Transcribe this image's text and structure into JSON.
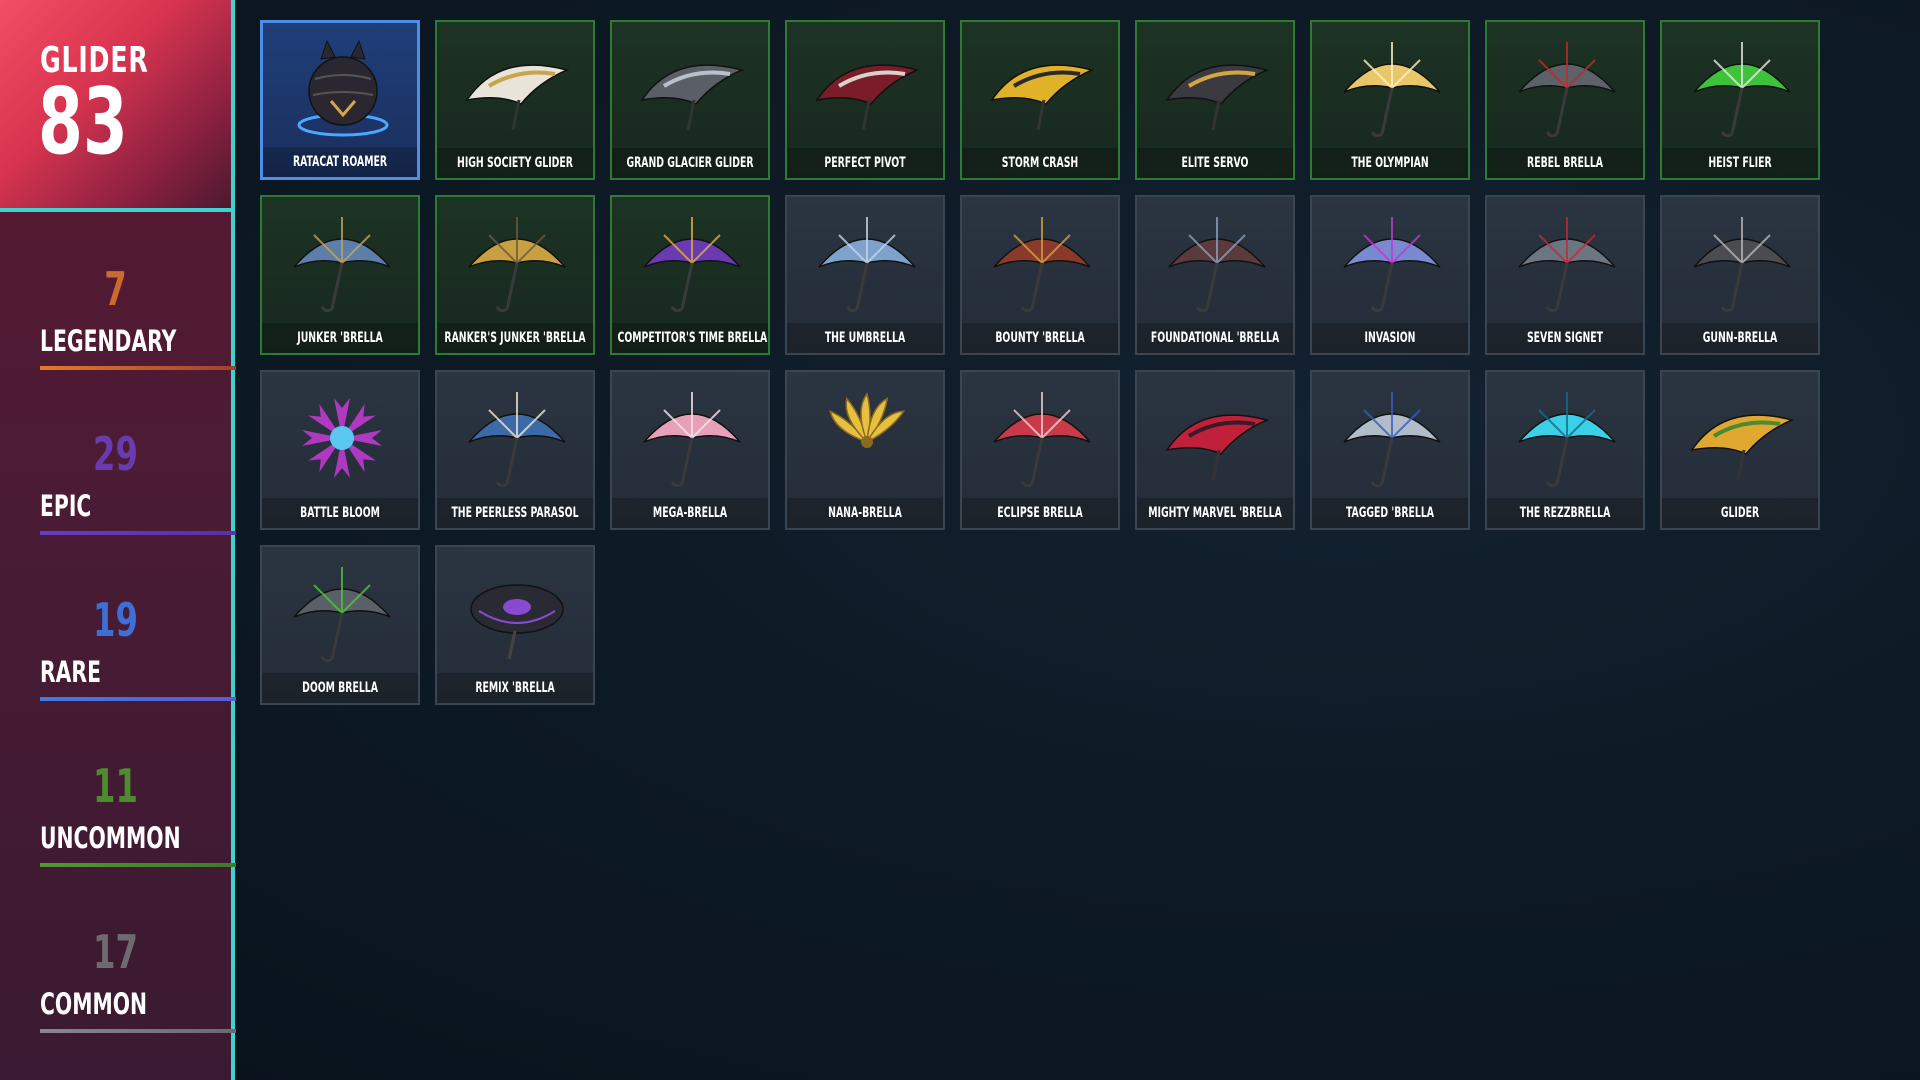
{
  "header": {
    "title": "GLIDER",
    "count": "83"
  },
  "rarities": [
    {
      "count": "7",
      "label": "LEGENDARY",
      "color": "#c96b2c",
      "bar": "linear-gradient(90deg,#e07a2e,#a2402e)"
    },
    {
      "count": "29",
      "label": "EPIC",
      "color": "#6a3bb0",
      "bar": "linear-gradient(90deg,#6b3bc4,#5a2fa8)"
    },
    {
      "count": "19",
      "label": "RARE",
      "color": "#3d6fd6",
      "bar": "linear-gradient(90deg,#3f7be0,#5e5ad0)"
    },
    {
      "count": "11",
      "label": "UNCOMMON",
      "color": "#4c8c2e",
      "bar": "linear-gradient(90deg,#4d9a2e,#3d7a2a)"
    },
    {
      "count": "17",
      "label": "COMMON",
      "color": "#6e6a72",
      "bar": "linear-gradient(90deg,#8a8690,#6c6872)"
    }
  ],
  "items": [
    {
      "name": "RATACAT ROAMER",
      "style": "selected",
      "icon": "ratacat-roamer-icon",
      "c1": "#2a2730",
      "c2": "#d8a64a",
      "shape": "ball"
    },
    {
      "name": "HIGH SOCIETY GLIDER",
      "style": "green",
      "icon": "high-society-icon",
      "c1": "#e8e4da",
      "c2": "#c9a54a",
      "shape": "wing"
    },
    {
      "name": "GRAND GLACIER GLIDER",
      "style": "green",
      "icon": "grand-glacier-icon",
      "c1": "#5a5f66",
      "c2": "#b8c0c8",
      "shape": "wing"
    },
    {
      "name": "PERFECT PIVOT",
      "style": "green",
      "icon": "perfect-pivot-icon",
      "c1": "#7a1c2a",
      "c2": "#d8d2c8",
      "shape": "wing"
    },
    {
      "name": "STORM CRASH",
      "style": "green",
      "icon": "storm-crash-icon",
      "c1": "#e0b22a",
      "c2": "#2a2a2e",
      "shape": "wing"
    },
    {
      "name": "ELITE SERVO",
      "style": "green",
      "icon": "elite-servo-icon",
      "c1": "#3a3a40",
      "c2": "#d4a640",
      "shape": "wing"
    },
    {
      "name": "THE OLYMPIAN",
      "style": "green",
      "icon": "olympian-icon",
      "c1": "#e8c66a",
      "c2": "#fff2c4",
      "shape": "umbrella"
    },
    {
      "name": "REBEL BRELLA",
      "style": "green",
      "icon": "rebel-brella-icon",
      "c1": "#5c6268",
      "c2": "#c02a2a",
      "shape": "umbrella"
    },
    {
      "name": "HEIST FLIER",
      "style": "green",
      "icon": "heist-flier-icon",
      "c1": "#3dc23a",
      "c2": "#e8e8e8",
      "shape": "umbrella"
    },
    {
      "name": "JUNKER 'BRELLA",
      "style": "green",
      "icon": "junker-brella-icon",
      "c1": "#5c7ea8",
      "c2": "#c7a45a",
      "shape": "umbrella"
    },
    {
      "name": "RANKER'S JUNKER 'BRELLA",
      "style": "green",
      "icon": "rankers-junker-icon",
      "c1": "#c9a040",
      "c2": "#6a5a40",
      "shape": "umbrella"
    },
    {
      "name": "COMPETITOR'S TIME BRELLA",
      "style": "green",
      "icon": "competitors-time-icon",
      "c1": "#6a3ab0",
      "c2": "#e0b040",
      "shape": "umbrella"
    },
    {
      "name": "THE UMBRELLA",
      "style": "plain",
      "icon": "the-umbrella-icon",
      "c1": "#7da2cc",
      "c2": "#c4d6ea",
      "shape": "umbrella"
    },
    {
      "name": "BOUNTY 'BRELLA",
      "style": "plain",
      "icon": "bounty-brella-icon",
      "c1": "#8a3a2a",
      "c2": "#d8a040",
      "shape": "umbrella"
    },
    {
      "name": "FOUNDATIONAL 'BRELLA",
      "style": "plain",
      "icon": "foundational-icon",
      "c1": "#5a3a3a",
      "c2": "#8aa0c0",
      "shape": "umbrella"
    },
    {
      "name": "INVASION",
      "style": "plain",
      "icon": "invasion-icon",
      "c1": "#7a8ad0",
      "c2": "#c03ad0",
      "shape": "umbrella"
    },
    {
      "name": "SEVEN SIGNET",
      "style": "plain",
      "icon": "seven-signet-icon",
      "c1": "#6c7682",
      "c2": "#c02a3a",
      "shape": "umbrella"
    },
    {
      "name": "GUNN-BRELLA",
      "style": "plain",
      "icon": "gunn-brella-icon",
      "c1": "#4a4c52",
      "c2": "#b8b8b8",
      "shape": "umbrella"
    },
    {
      "name": "BATTLE BLOOM",
      "style": "plain",
      "icon": "battle-bloom-icon",
      "c1": "#c03ad0",
      "c2": "#5ac8f0",
      "shape": "flower"
    },
    {
      "name": "THE PEERLESS PARASOL",
      "style": "plain",
      "icon": "peerless-parasol-icon",
      "c1": "#3c6aa8",
      "c2": "#f0e6d0",
      "shape": "umbrella"
    },
    {
      "name": "MEGA-BRELLA",
      "style": "plain",
      "icon": "mega-brella-icon",
      "c1": "#e8a0b8",
      "c2": "#f6e6ee",
      "shape": "umbrella"
    },
    {
      "name": "NANA-BRELLA",
      "style": "plain",
      "icon": "nana-brella-icon",
      "c1": "#e8c040",
      "c2": "#8a6a20",
      "shape": "banana"
    },
    {
      "name": "ECLIPSE BRELLA",
      "style": "plain",
      "icon": "eclipse-brella-icon",
      "c1": "#c83a4a",
      "c2": "#f0d0d4",
      "shape": "umbrella"
    },
    {
      "name": "MIGHTY MARVEL 'BRELLA",
      "style": "plain",
      "icon": "mighty-marvel-icon",
      "c1": "#c0203a",
      "c2": "#3a1a2a",
      "shape": "wing"
    },
    {
      "name": "TAGGED 'BRELLA",
      "style": "plain",
      "icon": "tagged-brella-icon",
      "c1": "#b0bcc8",
      "c2": "#3a5ac0",
      "shape": "umbrella"
    },
    {
      "name": "THE REZZBRELLA",
      "style": "plain",
      "icon": "rezzbrella-icon",
      "c1": "#3ad0e8",
      "c2": "#1a6a8a",
      "shape": "umbrella"
    },
    {
      "name": "GLIDER",
      "style": "plain",
      "icon": "default-glider-icon",
      "c1": "#e0a830",
      "c2": "#4a8a30",
      "shape": "wing"
    },
    {
      "name": "DOOM BRELLA",
      "style": "plain",
      "icon": "doom-brella-icon",
      "c1": "#5a6068",
      "c2": "#4ac83a",
      "shape": "umbrella"
    },
    {
      "name": "REMIX 'BRELLA",
      "style": "plain",
      "icon": "remix-brella-icon",
      "c1": "#2a2a34",
      "c2": "#8a4ad0",
      "shape": "disc"
    }
  ]
}
